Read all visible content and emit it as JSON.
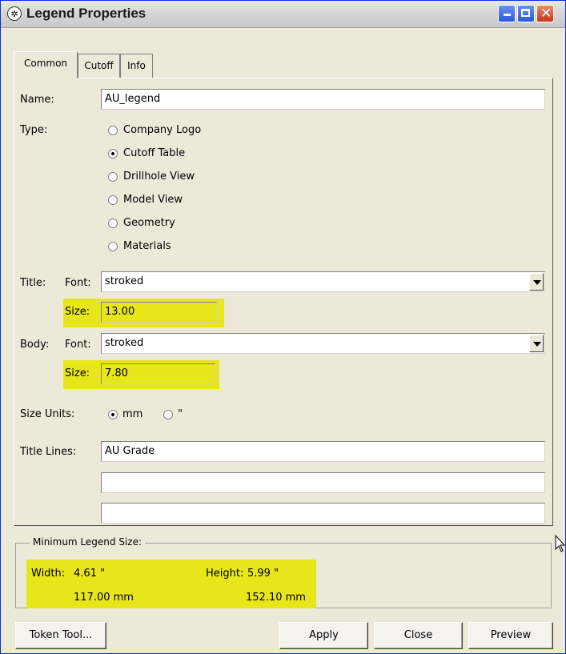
{
  "window": {
    "title": "Legend Properties",
    "controls": {
      "minimize": "_",
      "maximize": "□",
      "close": "✕"
    }
  },
  "tabs": [
    "Common",
    "Cutoff",
    "Info"
  ],
  "form": {
    "name_label": "Name:",
    "name_value": "AU_legend",
    "type_label": "Type:",
    "type_options": [
      "Company Logo",
      "Cutoff Table",
      "Drillhole View",
      "Model View",
      "Geometry",
      "Materials"
    ],
    "type_selected": "Cutoff Table",
    "title_label": "Title:",
    "title_font_label": "Font:",
    "title_font_value": "stroked",
    "title_size_label": "Size:",
    "title_size_value": "13.00",
    "body_label": "Body:",
    "body_font_label": "Font:",
    "body_font_value": "stroked",
    "body_size_label": "Size:",
    "body_size_value": "7.80",
    "size_units_label": "Size Units:",
    "size_units_options": [
      "mm",
      "\""
    ],
    "size_units_selected": "mm",
    "title_lines_label": "Title Lines:",
    "title_lines": [
      "AU Grade",
      "",
      ""
    ]
  },
  "min_size": {
    "group_label": "Minimum Legend Size:",
    "width_label": "Width:",
    "width_in": "4.61 \"",
    "width_mm": "117.00 mm",
    "height_label": "Height:",
    "height_in": "5.99 \"",
    "height_mm": "152.10 mm"
  },
  "buttons": {
    "token_tool": "Token Tool...",
    "apply": "Apply",
    "close": "Close",
    "preview": "Preview"
  },
  "colors": {
    "highlight": "#e6e61a",
    "dialog_bg": "#ece9d8",
    "title_border": "#0831d9"
  }
}
